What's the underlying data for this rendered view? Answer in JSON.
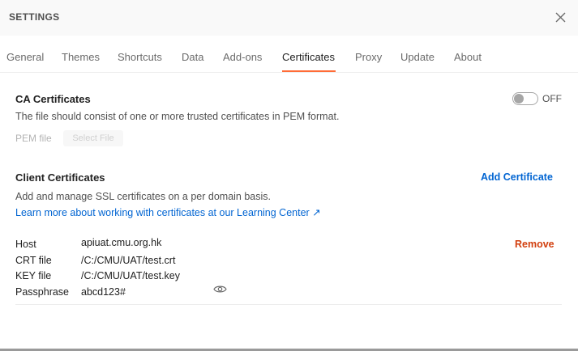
{
  "header": {
    "title": "SETTINGS"
  },
  "tabs": [
    {
      "label": "General"
    },
    {
      "label": "Themes"
    },
    {
      "label": "Shortcuts"
    },
    {
      "label": "Data"
    },
    {
      "label": "Add-ons"
    },
    {
      "label": "Certificates",
      "active": true
    },
    {
      "label": "Proxy"
    },
    {
      "label": "Update"
    },
    {
      "label": "About"
    }
  ],
  "ca": {
    "title": "CA Certificates",
    "description": "The file should consist of one or more trusted certificates in PEM format.",
    "toggle_state": "OFF",
    "pem_label": "PEM file",
    "select_file_label": "Select File"
  },
  "client": {
    "title": "Client Certificates",
    "add_label": "Add Certificate",
    "description": "Add and manage SSL certificates on a per domain basis.",
    "learn_link": "Learn more about working with certificates at our Learning Center ↗",
    "certificate": {
      "host_label": "Host",
      "host": "apiuat.cmu.org.hk",
      "crt_label": "CRT file",
      "crt": "/C:/CMU/UAT/test.crt",
      "key_label": "KEY file",
      "key": "/C:/CMU/UAT/test.key",
      "pass_label": "Passphrase",
      "passphrase": "abcd123#",
      "remove_label": "Remove"
    }
  },
  "colors": {
    "accent": "#ff6c37",
    "link": "#0265d2",
    "danger": "#d23f0e"
  },
  "icons": {
    "close": "close-icon",
    "eye": "eye-icon",
    "external": "external-link-arrow"
  }
}
